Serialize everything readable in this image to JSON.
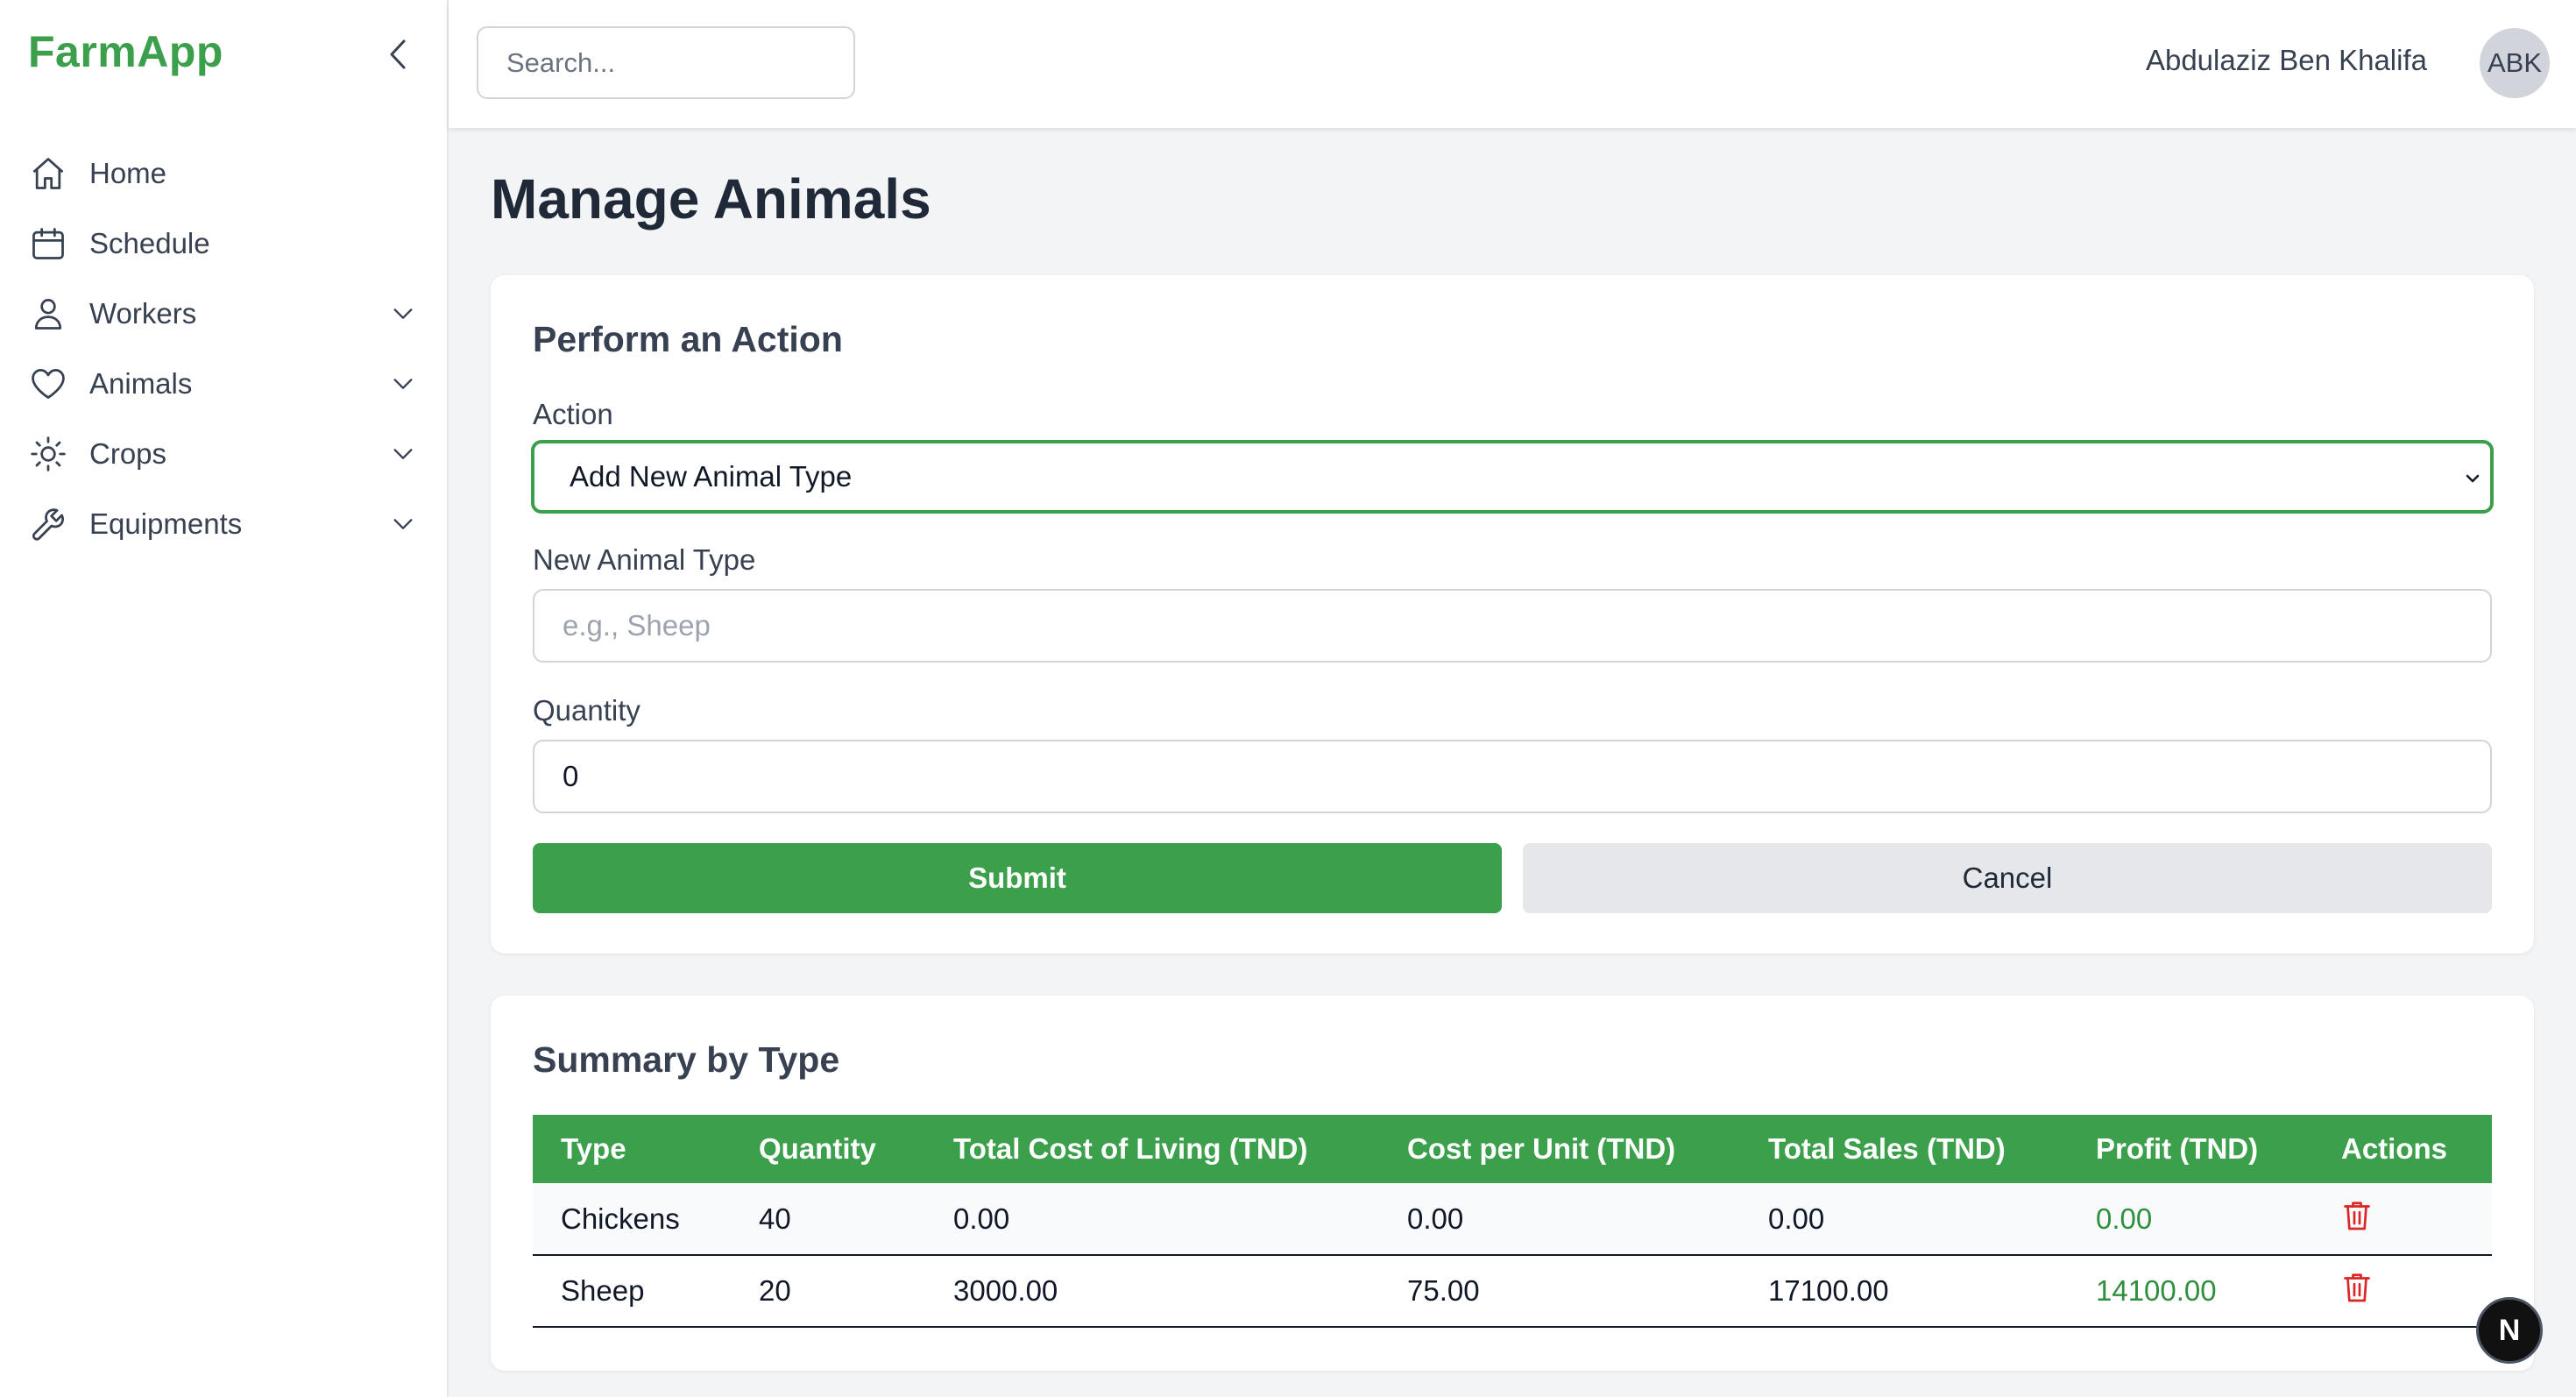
{
  "app": {
    "brand": "FarmApp"
  },
  "sidebar": {
    "items": [
      {
        "label": "Home",
        "icon": "home-icon",
        "has_submenu": false
      },
      {
        "label": "Schedule",
        "icon": "calendar-icon",
        "has_submenu": false
      },
      {
        "label": "Workers",
        "icon": "user-icon",
        "has_submenu": true
      },
      {
        "label": "Animals",
        "icon": "heart-icon",
        "has_submenu": true
      },
      {
        "label": "Crops",
        "icon": "sun-icon",
        "has_submenu": true
      },
      {
        "label": "Equipments",
        "icon": "wrench-icon",
        "has_submenu": true
      }
    ]
  },
  "header": {
    "search_placeholder": "Search...",
    "user_name": "Abdulaziz Ben Khalifa",
    "user_initials": "ABK"
  },
  "page": {
    "title": "Manage Animals"
  },
  "action_form": {
    "title": "Perform an Action",
    "action_label": "Action",
    "action_selected": "Add New Animal Type",
    "type_label": "New Animal Type",
    "type_placeholder": "e.g., Sheep",
    "quantity_label": "Quantity",
    "quantity_value": "0",
    "submit_label": "Submit",
    "cancel_label": "Cancel"
  },
  "summary": {
    "title": "Summary by Type",
    "columns": [
      "Type",
      "Quantity",
      "Total Cost of Living (TND)",
      "Cost per Unit (TND)",
      "Total Sales (TND)",
      "Profit (TND)",
      "Actions"
    ],
    "rows": [
      {
        "type": "Chickens",
        "quantity": "40",
        "total_cost": "0.00",
        "cost_per_unit": "0.00",
        "total_sales": "0.00",
        "profit": "0.00"
      },
      {
        "type": "Sheep",
        "quantity": "20",
        "total_cost": "3000.00",
        "cost_per_unit": "75.00",
        "total_sales": "17100.00",
        "profit": "14100.00"
      }
    ]
  },
  "floating_badge": {
    "label": "N"
  },
  "colors": {
    "brand": "#3c9f4b",
    "profit": "#2f8f3e",
    "danger": "#dc2626"
  }
}
